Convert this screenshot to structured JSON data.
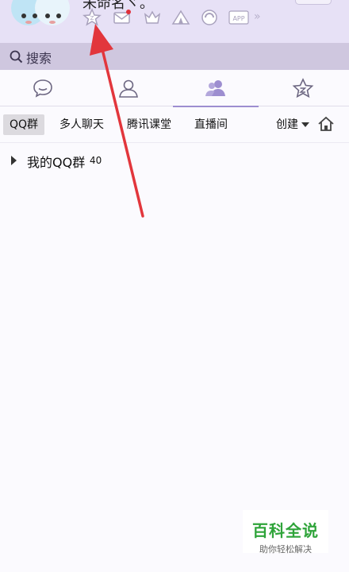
{
  "header": {
    "nickname": "未命名ヾ。",
    "status_icons": [
      {
        "name": "qzone-star-icon"
      },
      {
        "name": "mail-icon"
      },
      {
        "name": "crown-icon"
      },
      {
        "name": "tent-icon"
      },
      {
        "name": "circle-app-icon"
      },
      {
        "name": "app-icon",
        "label": "APP"
      },
      {
        "name": "more-chevron-icon",
        "label": "»"
      }
    ]
  },
  "search": {
    "placeholder": "搜索"
  },
  "main_tabs": [
    {
      "icon": "chat-bubble-icon",
      "active": false
    },
    {
      "icon": "contact-person-icon",
      "active": false
    },
    {
      "icon": "group-icon",
      "active": true
    },
    {
      "icon": "star-icon",
      "active": false
    }
  ],
  "sub_tabs": [
    {
      "label": "QQ群",
      "active": true
    },
    {
      "label": "多人聊天",
      "active": false
    },
    {
      "label": "腾讯课堂",
      "active": false
    },
    {
      "label": "直播间",
      "active": false
    }
  ],
  "create_label": "创建",
  "groups": [
    {
      "label": "我的QQ群",
      "count": "40"
    }
  ],
  "watermark": {
    "title": "百科全说",
    "subtitle": "助你轻松解决"
  },
  "colors": {
    "header_bg": "#e7e1f6",
    "search_bg": "#cfc7df",
    "accent": "#9d8ed0",
    "annotation_arrow": "#e2363c",
    "watermark_green": "#2fa43a"
  }
}
